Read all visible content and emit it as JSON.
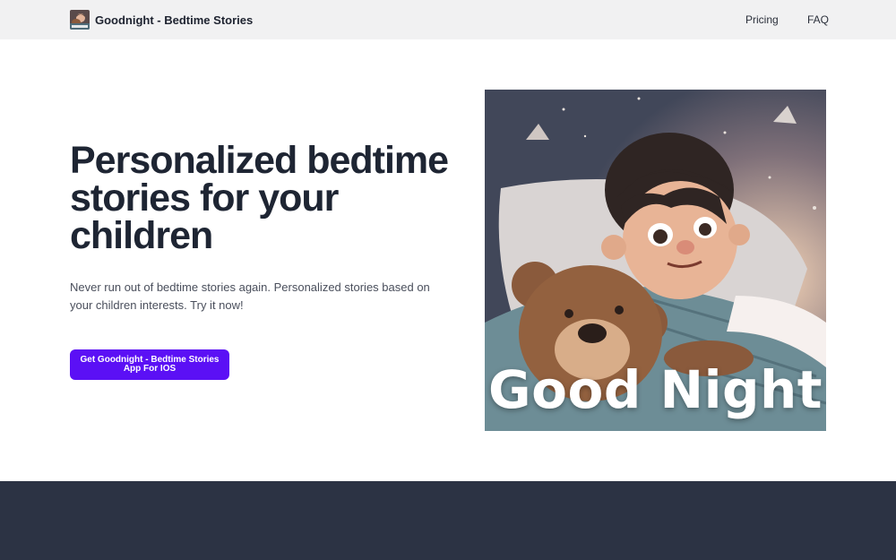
{
  "header": {
    "brand_name": "Goodnight - Bedtime Stories",
    "logo_icon": "app-logo-icon",
    "nav": [
      {
        "label": "Pricing"
      },
      {
        "label": "FAQ"
      }
    ]
  },
  "hero": {
    "title": "Personalized bedtime stories for your children",
    "subtitle": "Never run out of bedtime stories again. Personalized stories based on your children interests. Try it now!",
    "cta_label": "Get Goodnight - Bedtime Stories App For IOS",
    "image_caption": "Good Night"
  },
  "colors": {
    "cta": "#5b10f5",
    "header_bg": "#f1f1f2",
    "footer_bg": "#2c3344",
    "title": "#1e2533"
  }
}
